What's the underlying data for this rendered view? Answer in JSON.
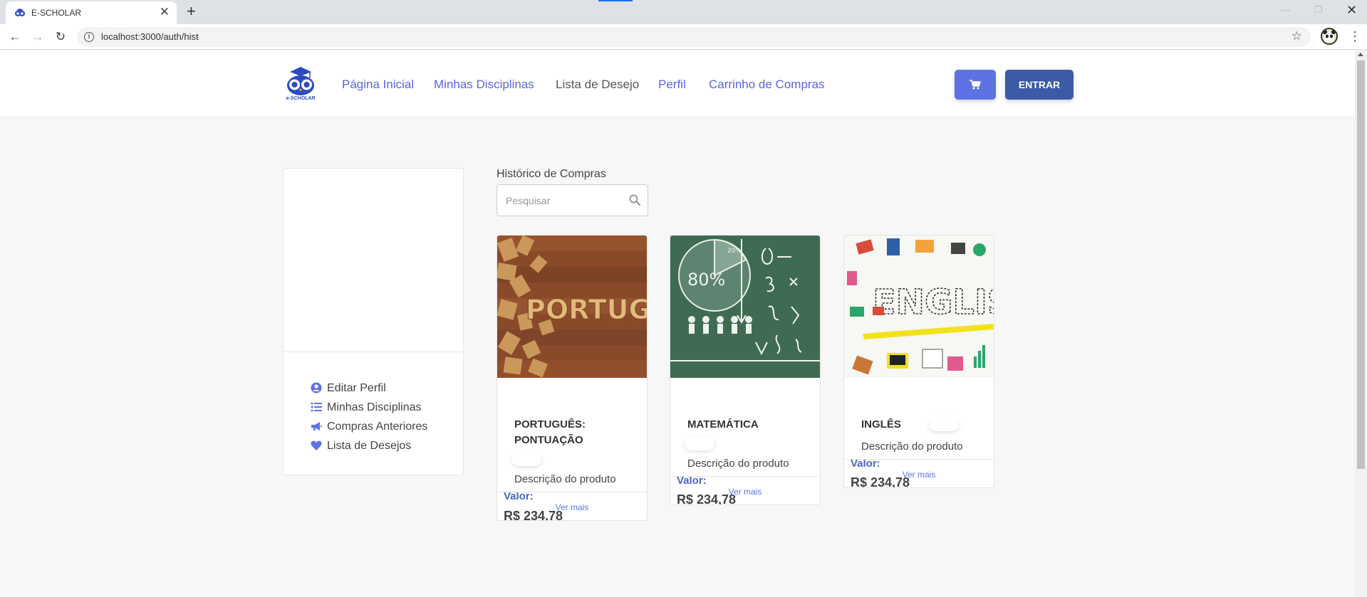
{
  "browser": {
    "tab_title": "E-SCHOLAR",
    "url": "localhost:3000/auth/hist"
  },
  "header": {
    "logo_text": "e-SCHOLAR",
    "nav": [
      "Página Inicial",
      "Minhas Disciplinas",
      "Lista de Desejo",
      "Perfil",
      "Carrinho de Compras"
    ],
    "active_nav": "Lista de Desejo",
    "login_label": "ENTRAR"
  },
  "sidebar": {
    "items": [
      {
        "label": "Editar Perfil",
        "icon": "user-circle-icon"
      },
      {
        "label": "Minhas Disciplinas",
        "icon": "list-icon"
      },
      {
        "label": "Compras Anteriores",
        "icon": "megaphone-icon"
      },
      {
        "label": "Lista de Desejos",
        "icon": "heart-icon"
      }
    ]
  },
  "content": {
    "title": "Histórico de Compras",
    "search_placeholder": "Pesquisar",
    "products": [
      {
        "title": "PORTUGUÊS: PONTUAÇÃO",
        "description": "Descrição do produto",
        "price_label": "Valor:",
        "price": "R$ 234,78",
        "more": "Ver mais",
        "image": "wooden-letters-portugues"
      },
      {
        "title": "MATEMÁTICA",
        "description": "Descrição do produto",
        "price_label": "Valor:",
        "price": "R$ 234,78",
        "more": "Ver mais",
        "image": "chalkboard-math"
      },
      {
        "title": "INGLÊS",
        "description": "Descrição do produto",
        "price_label": "Valor:",
        "price": "R$ 234,78",
        "more": "Ver mais",
        "image": "english-doodle"
      }
    ]
  },
  "colors": {
    "accent": "#5e72e4",
    "login": "#3b5ba7",
    "nav_link": "#5965e0"
  }
}
